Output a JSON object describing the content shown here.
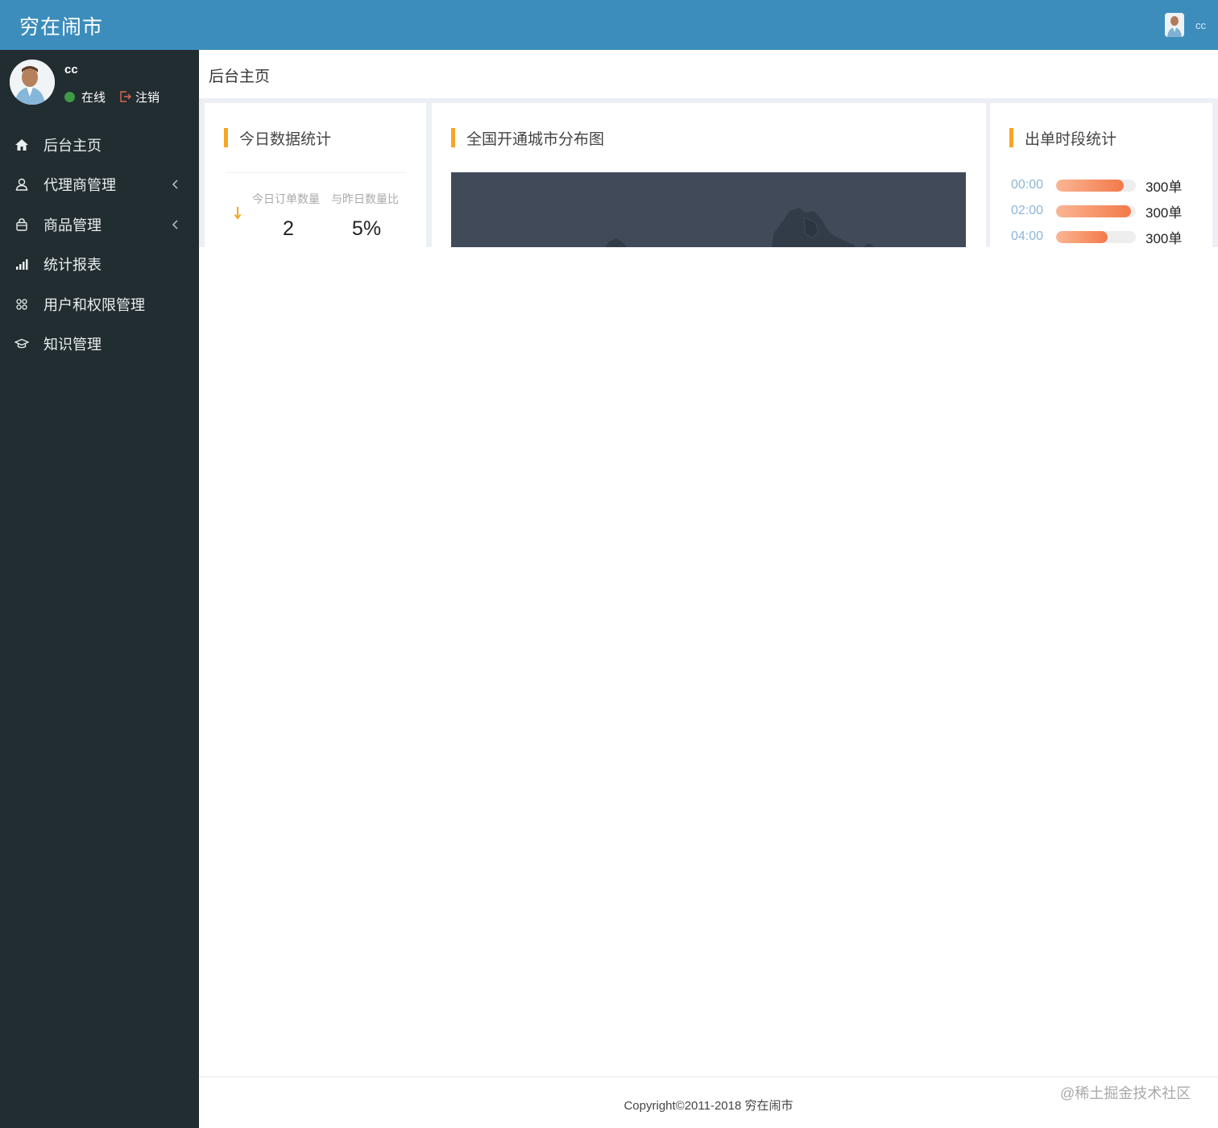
{
  "header": {
    "brand": "穷在闹市",
    "username": "cc"
  },
  "sidebar": {
    "user": {
      "name": "cc",
      "status": "在线",
      "status_color": "#3d9a45",
      "logout": "注销"
    },
    "items": [
      {
        "label": "后台主页",
        "icon": "home-icon",
        "has_submenu": false
      },
      {
        "label": "代理商管理",
        "icon": "user-icon",
        "has_submenu": true
      },
      {
        "label": "商品管理",
        "icon": "bag-icon",
        "has_submenu": true
      },
      {
        "label": "统计报表",
        "icon": "bar-chart-icon",
        "has_submenu": false
      },
      {
        "label": "用户和权限管理",
        "icon": "grid-icon",
        "has_submenu": false
      },
      {
        "label": "知识管理",
        "icon": "graduation-cap-icon",
        "has_submenu": false
      }
    ]
  },
  "page": {
    "title": "后台主页"
  },
  "today_stats": {
    "title": "今日数据统计",
    "trend": "down",
    "columns": [
      {
        "header": "今日订单数量",
        "value": "2"
      },
      {
        "header": "与昨日数量比",
        "value": "5%"
      }
    ]
  },
  "city_map": {
    "title": "全国开通城市分布图"
  },
  "order_time": {
    "title": "出单时段统计",
    "rows": [
      {
        "time": "00:00",
        "count": "300单",
        "fill": 0.85
      },
      {
        "time": "02:00",
        "count": "300单",
        "fill": 0.94
      },
      {
        "time": "04:00",
        "count": "300单",
        "fill": 0.65
      }
    ]
  },
  "footer": {
    "copyright": "Copyright©2011-2018 穷在闹市",
    "watermark": "@稀土掘金技术社区"
  },
  "colors": {
    "header": "#3c8dbc",
    "sidebar": "#222d32",
    "accent": "#f5a623",
    "map_bg": "#404a59",
    "bar_start": "#fbb594",
    "bar_end": "#f37a4a"
  }
}
